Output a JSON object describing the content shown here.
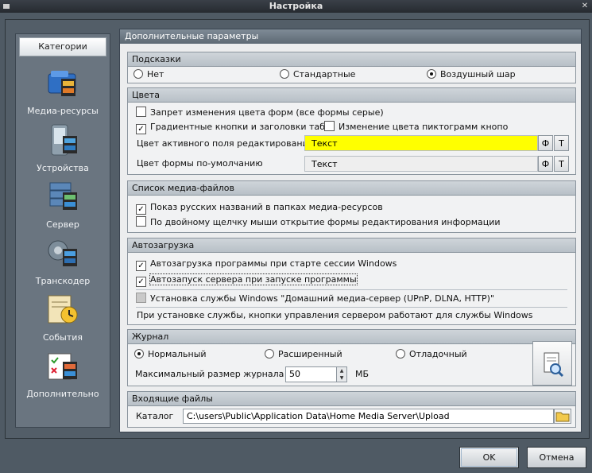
{
  "window": {
    "title": "Настройка",
    "close_glyph": "✕"
  },
  "sidebar": {
    "header": "Категории",
    "items": [
      {
        "label": "Медиа-ресурсы",
        "icon": "media-resources-icon"
      },
      {
        "label": "Устройства",
        "icon": "devices-icon"
      },
      {
        "label": "Сервер",
        "icon": "server-icon"
      },
      {
        "label": "Транскодер",
        "icon": "transcoder-icon"
      },
      {
        "label": "События",
        "icon": "events-icon"
      },
      {
        "label": "Дополнительно",
        "icon": "additional-icon"
      }
    ]
  },
  "main": {
    "title": "Дополнительные параметры",
    "hints": {
      "title": "Подсказки",
      "options": [
        "Нет",
        "Стандартные",
        "Воздушный шар"
      ],
      "selected": "Воздушный шар"
    },
    "colors": {
      "title": "Цвета",
      "forbid_change": "Запрет изменения цвета форм (все формы серые)",
      "gradient_buttons": "Градиентные кнопки и заголовки табл",
      "change_icon_color": "Изменение цвета пиктограмм кнопо",
      "active_field_label": "Цвет активного поля редактирования",
      "active_field_value": "Текст",
      "active_field_color": "#ffff00",
      "default_form_label": "Цвет формы по-умолчанию",
      "default_form_value": "Текст",
      "btn_f": "Ф",
      "btn_t": "Т"
    },
    "media_list": {
      "title": "Список медиа-файлов",
      "show_russian": "Показ русских названий в папках медиа-ресурсов",
      "double_click": "По двойному щелчку мыши открытие формы редактирования информации"
    },
    "autoload": {
      "title": "Автозагрузка",
      "autoload_program": "Автозагрузка программы при старте сессии Windows",
      "autostart_server": "Автозапуск сервера при запуске программы",
      "install_service": "Установка службы Windows \"Домашний медиа-сервер (UPnP, DLNA, HTTP)\"",
      "service_note": "При установке службы, кнопки управления сервером работают для службы Windows"
    },
    "journal": {
      "title": "Журнал",
      "options": [
        "Нормальный",
        "Расширенный",
        "Отладочный"
      ],
      "selected": "Нормальный",
      "max_size_label": "Максимальный размер  журнала",
      "max_size_value": "50",
      "unit": "МБ"
    },
    "incoming": {
      "title": "Входящие файлы",
      "catalog_label": "Каталог",
      "catalog_path": "C:\\users\\Public\\Application Data\\Home Media Server\\Upload"
    }
  },
  "buttons": {
    "ok": "OK",
    "cancel": "Отмена"
  }
}
